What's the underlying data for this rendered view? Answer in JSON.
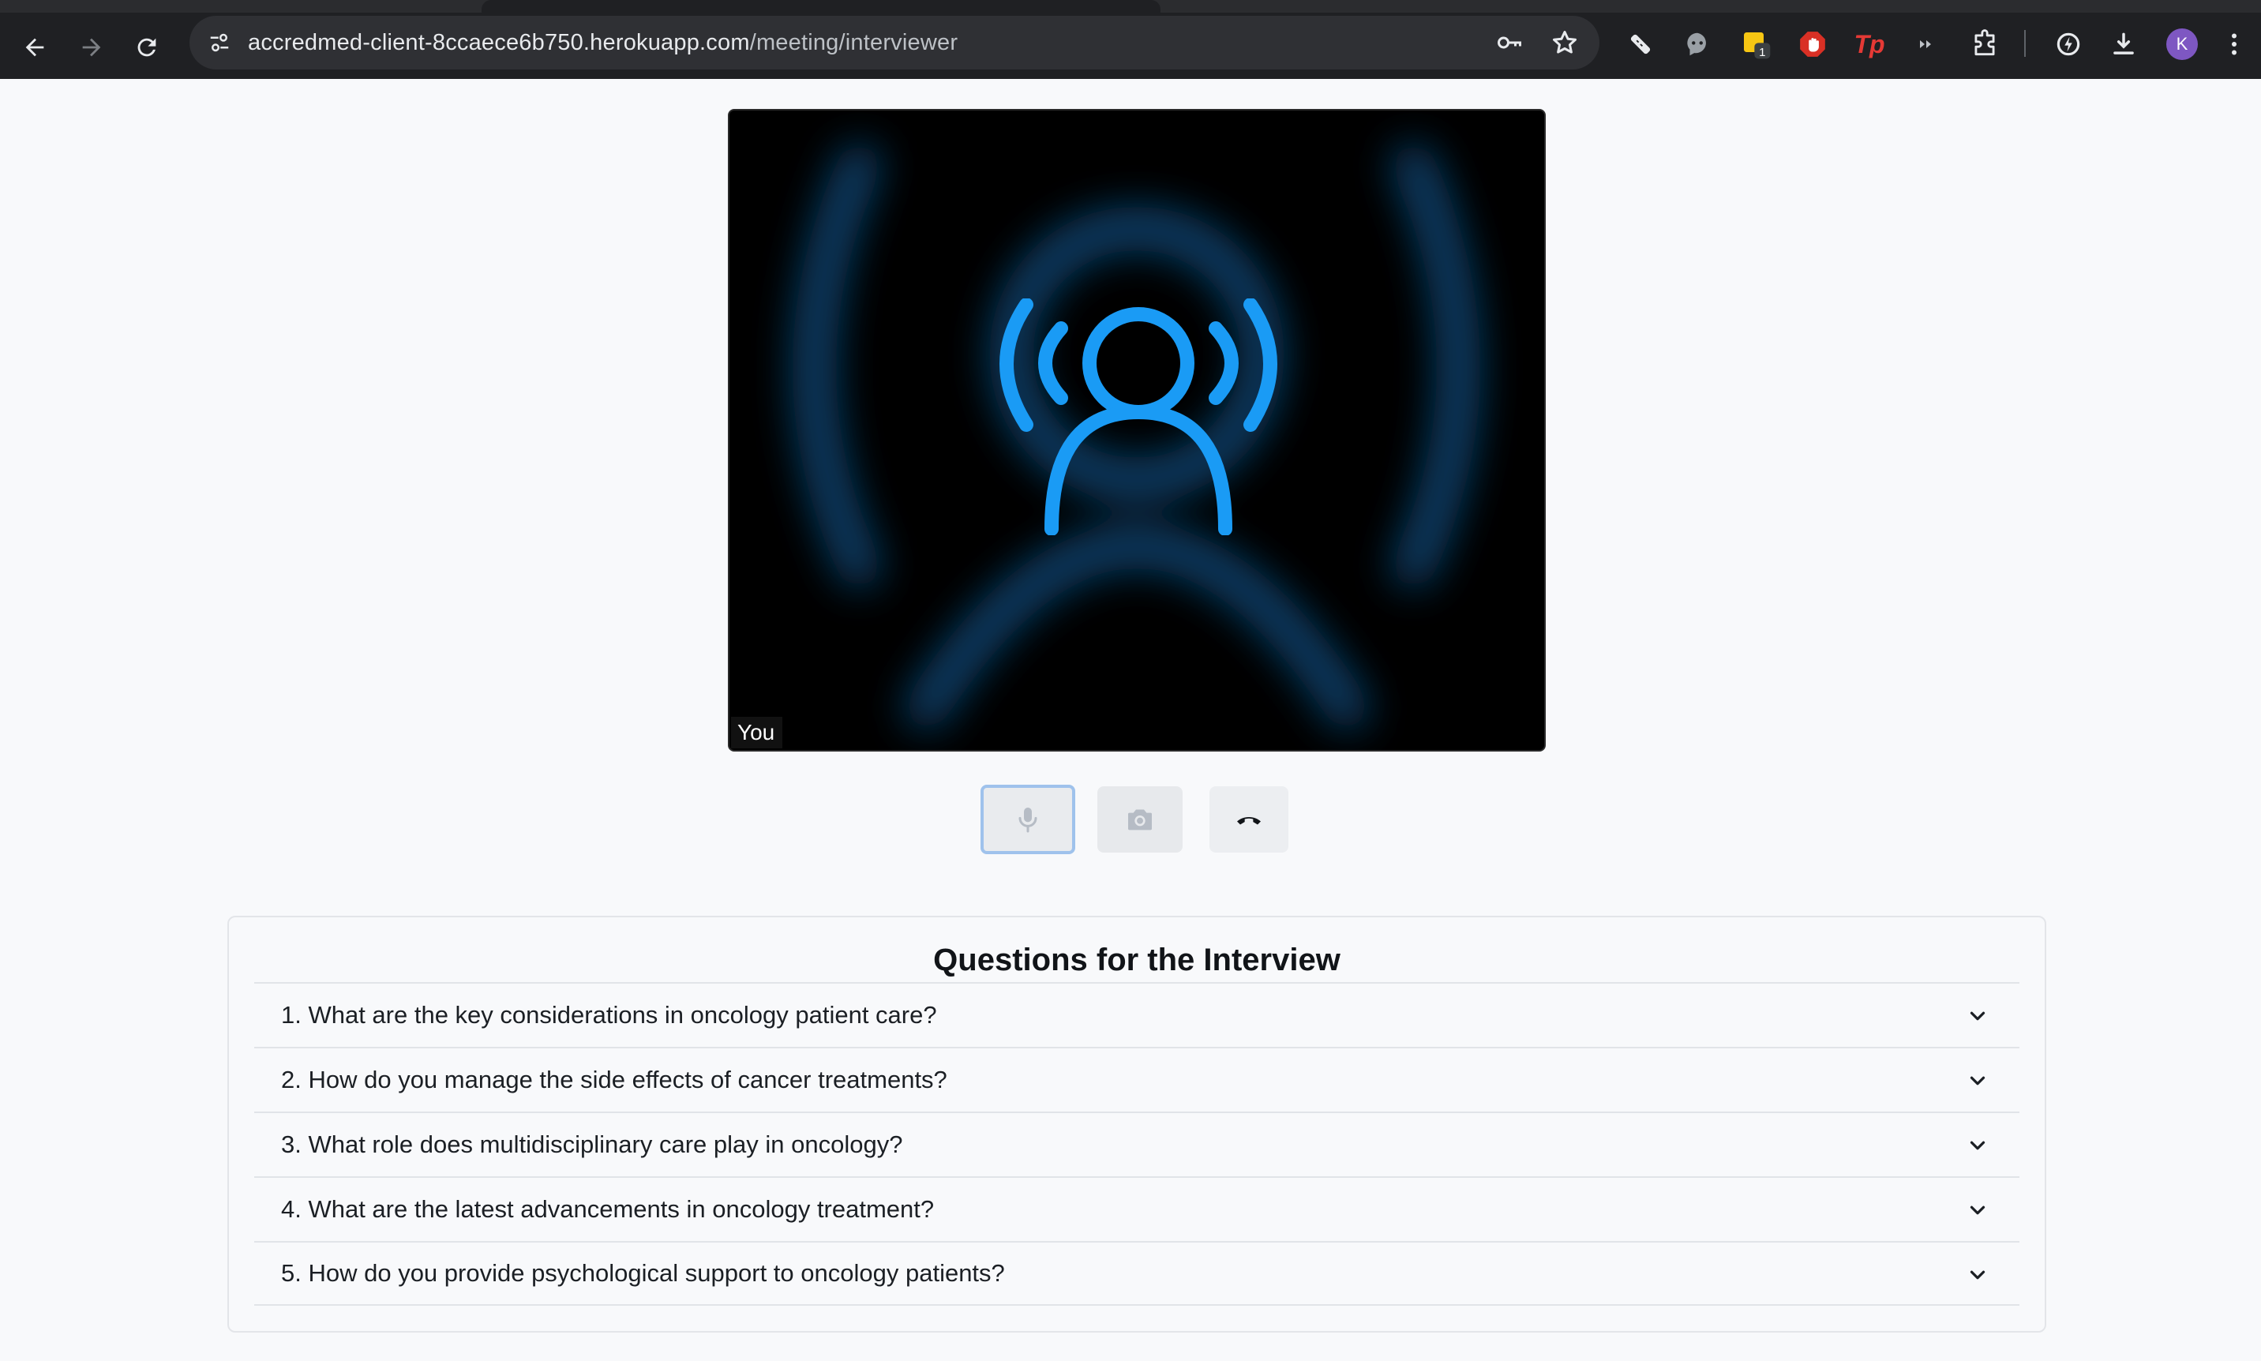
{
  "browser": {
    "url_host": "accredmed-client-8ccaece6b750.herokuapp.com",
    "url_path": "/meeting/interviewer",
    "extension_badge": "1",
    "extension_tp_label": "Tp",
    "profile_initial": "K"
  },
  "video": {
    "self_label": "You"
  },
  "controls": {
    "mic_icon": "microphone-icon",
    "camera_icon": "camera-icon",
    "hangup_icon": "phone-hangup-icon"
  },
  "questions": {
    "title": "Questions for the Interview",
    "items": [
      "1. What are the key considerations in oncology patient care?",
      "2. How do you manage the side effects of cancer treatments?",
      "3. What role does multidisciplinary care play in oncology?",
      "4. What are the latest advancements in oncology treatment?",
      "5. How do you provide psychological support to oncology patients?"
    ]
  },
  "colors": {
    "accent_blue": "#1a9bf5",
    "chrome_bg": "#1f2023",
    "page_bg": "#f8f9fb"
  }
}
